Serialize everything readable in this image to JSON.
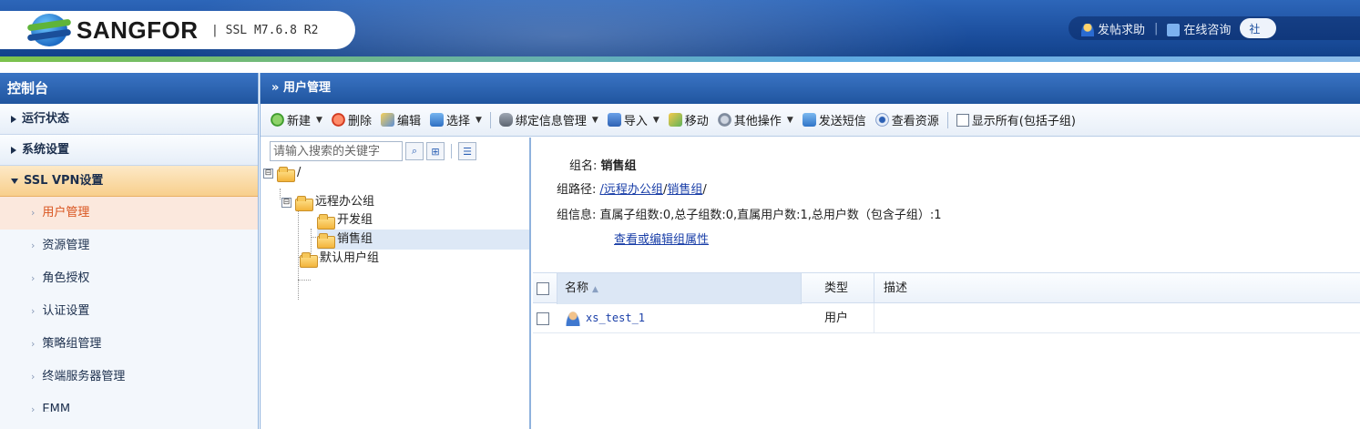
{
  "header": {
    "brand": "SANGFOR",
    "separator": "|",
    "version": "SSL M7.6.8 R2",
    "help_link": "发帖求助",
    "consult_link": "在线咨询",
    "extra_pill": "社",
    "divider": "|"
  },
  "sidebar": {
    "title": "控制台",
    "items": [
      {
        "label": "运行状态",
        "type": "top"
      },
      {
        "label": "系统设置",
        "type": "top"
      },
      {
        "label": "SSL VPN设置",
        "type": "top-open"
      }
    ],
    "sub_items": [
      {
        "label": "用户管理",
        "active": true
      },
      {
        "label": "资源管理"
      },
      {
        "label": "角色授权"
      },
      {
        "label": "认证设置"
      },
      {
        "label": "策略组管理"
      },
      {
        "label": "终端服务器管理"
      },
      {
        "label": "EMM"
      }
    ],
    "chevron": "›"
  },
  "panel": {
    "title": "用户管理",
    "title_prefix": "»"
  },
  "toolbar": {
    "new": "新建",
    "delete": "删除",
    "edit": "编辑",
    "select": "选择",
    "bind_info": "绑定信息管理",
    "import": "导入",
    "move": "移动",
    "other_ops": "其他操作",
    "send_sms": "发送短信",
    "view_resources": "查看资源",
    "show_all": "显示所有(包括子组)",
    "dropdown_glyph": "▼"
  },
  "tree": {
    "search_placeholder": "请输入搜索的关键字",
    "nodes": {
      "root": "/",
      "remote_office": "远程办公组",
      "dev": "开发组",
      "sales": "销售组",
      "default_users": "默认用户组"
    },
    "expand_glyph": "⊟"
  },
  "detail": {
    "group_name_label": "组名:",
    "group_name": "销售组",
    "group_path_label": "组路径:",
    "path_root": "/",
    "path_part1": "远程办公组",
    "path_sep": "/",
    "path_part2": "销售组",
    "path_end": "/",
    "group_info_label": "组信息:",
    "group_info": "直属子组数:0,总子组数:0,直属用户数:1,总用户数（包含子组）:1",
    "edit_link": "查看或编辑组属性"
  },
  "table": {
    "columns": [
      "名称",
      "类型",
      "描述"
    ],
    "sort_glyph": "▲",
    "rows": [
      {
        "name": "xs_test_1",
        "type": "用户",
        "desc": ""
      }
    ]
  }
}
